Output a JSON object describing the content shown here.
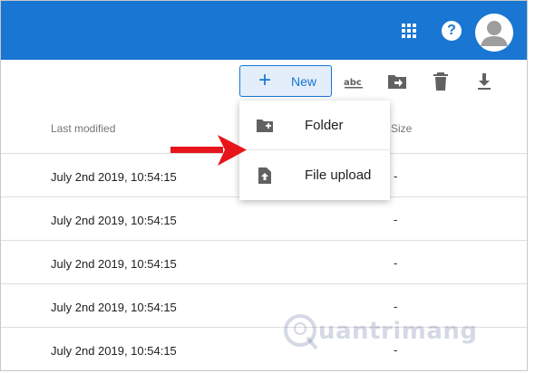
{
  "toolbar": {
    "new_label": "New"
  },
  "columns": {
    "last_modified": "Last modified",
    "size": "Size"
  },
  "rows": [
    {
      "modified": "July 2nd 2019, 10:54:15",
      "size": "-"
    },
    {
      "modified": "July 2nd 2019, 10:54:15",
      "size": "-"
    },
    {
      "modified": "July 2nd 2019, 10:54:15",
      "size": "-"
    },
    {
      "modified": "July 2nd 2019, 10:54:15",
      "size": "-"
    },
    {
      "modified": "July 2nd 2019, 10:54:15",
      "size": "-"
    }
  ],
  "new_menu": {
    "items": [
      {
        "label": "Folder",
        "icon": "folder-add-icon"
      },
      {
        "label": "File upload",
        "icon": "file-upload-icon"
      }
    ]
  },
  "watermark": {
    "text": "uantrimang"
  },
  "colors": {
    "header": "#1976d2",
    "accent": "#1976d2",
    "arrow": "#e8141b"
  }
}
